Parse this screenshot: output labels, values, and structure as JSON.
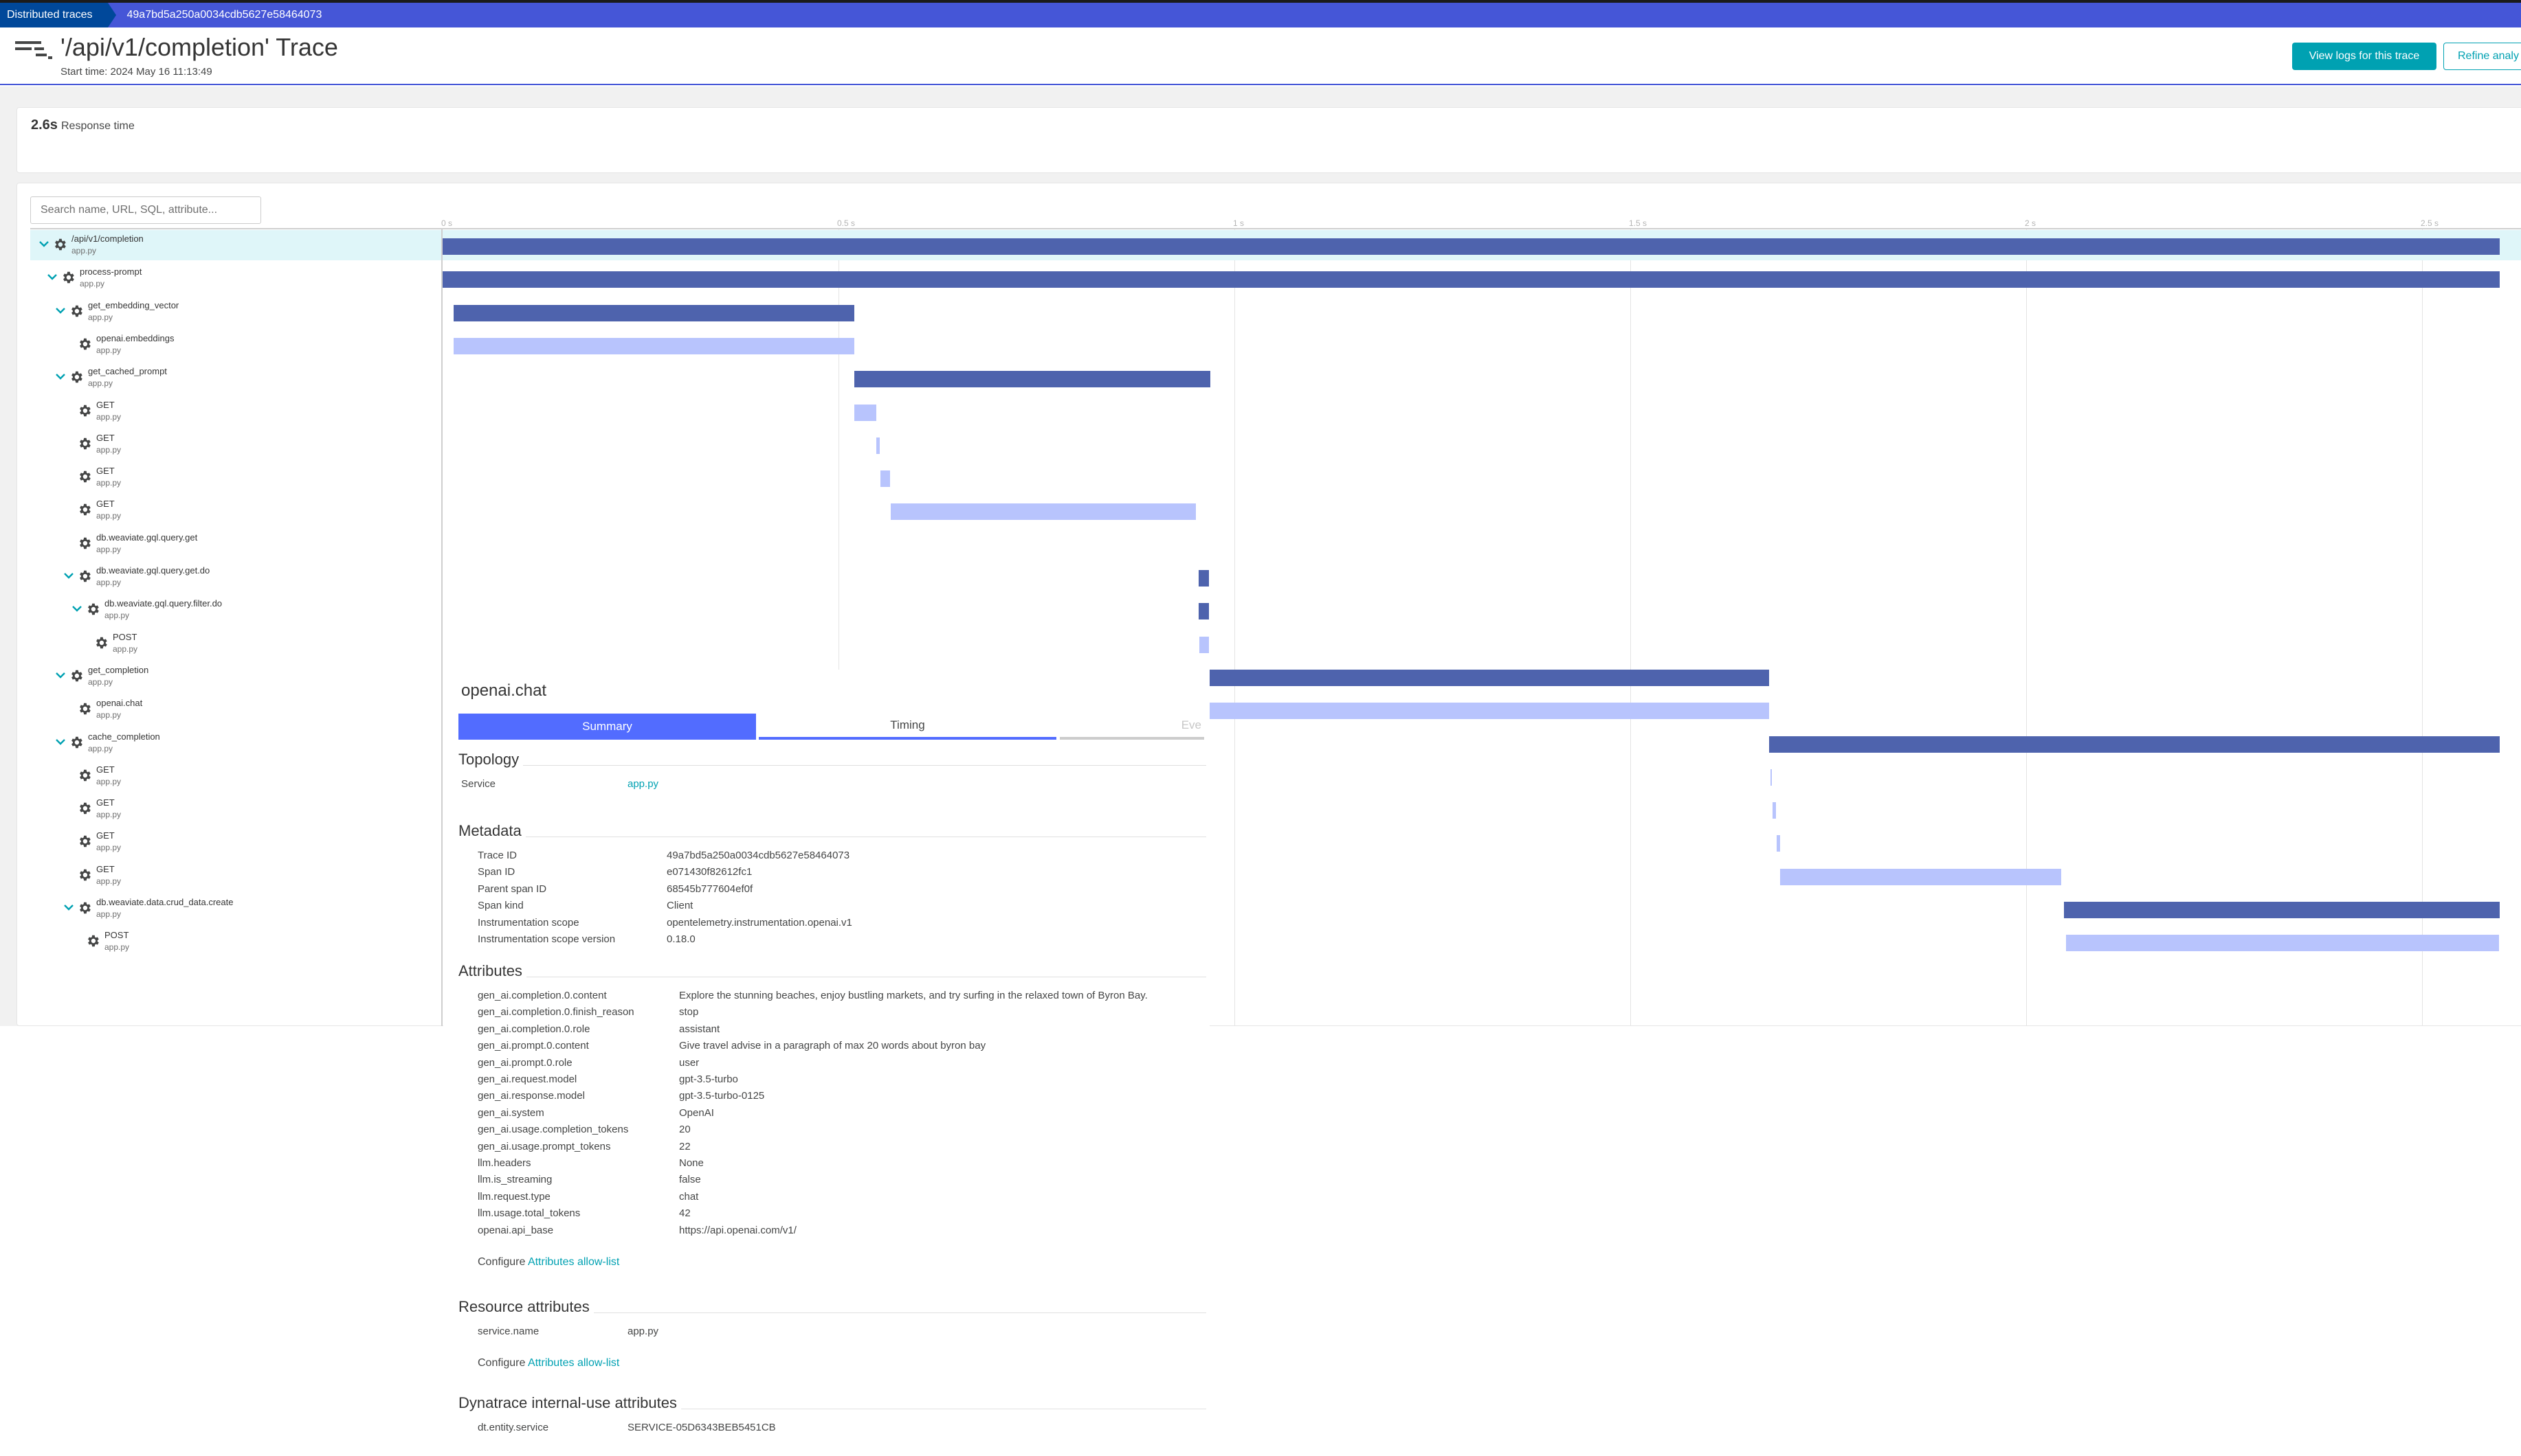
{
  "breadcrumb": {
    "items": [
      "Distributed traces",
      "49a7bd5a250a0034cdb5627e58464073"
    ]
  },
  "header": {
    "title": "'/api/v1/completion' Trace",
    "start_time": "Start time: 2024 May 16 11:13:49",
    "view_logs_button": "View logs for this trace",
    "refine_button": "Refine analy"
  },
  "summary": {
    "response_value": "2.6s",
    "response_label": "Response time"
  },
  "search": {
    "placeholder": "Search name, URL, SQL, attribute..."
  },
  "colors": {
    "accent": "#4556d7",
    "bar_parent": "#4e63ad",
    "bar_leaf": "#b8c4fd",
    "teal": "#00a1b2",
    "selected_row": "#dff6f9"
  },
  "chart_data": {
    "type": "gantt",
    "title": "",
    "xlabel": "",
    "unit": "s",
    "xlim": [
      0,
      2.65
    ],
    "ticks": [
      "0 s",
      "0.5 s",
      "1 s",
      "1.5 s",
      "2 s",
      "2.5 s"
    ],
    "tick_values": [
      0,
      0.5,
      1,
      1.5,
      2,
      2.5
    ],
    "spans": [
      {
        "name": "/api/v1/completion",
        "service": "app.py",
        "depth": 0,
        "expandable": true,
        "kind": "dark",
        "start": 0.0,
        "end": 2.598,
        "selected": true
      },
      {
        "name": "process-prompt",
        "service": "app.py",
        "depth": 1,
        "expandable": true,
        "kind": "dark",
        "start": 0.0,
        "end": 2.598
      },
      {
        "name": "get_embedding_vector",
        "service": "app.py",
        "depth": 2,
        "expandable": true,
        "kind": "dark",
        "start": 0.014,
        "end": 0.52
      },
      {
        "name": "openai.embeddings",
        "service": "app.py",
        "depth": 3,
        "expandable": false,
        "kind": "light",
        "start": 0.014,
        "end": 0.52
      },
      {
        "name": "get_cached_prompt",
        "service": "app.py",
        "depth": 2,
        "expandable": true,
        "kind": "dark",
        "start": 0.52,
        "end": 0.97
      },
      {
        "name": "GET",
        "service": "app.py",
        "depth": 3,
        "expandable": false,
        "kind": "light",
        "start": 0.52,
        "end": 0.548
      },
      {
        "name": "GET",
        "service": "app.py",
        "depth": 3,
        "expandable": false,
        "kind": "light",
        "start": 0.548,
        "end": 0.552
      },
      {
        "name": "GET",
        "service": "app.py",
        "depth": 3,
        "expandable": false,
        "kind": "light",
        "start": 0.553,
        "end": 0.565
      },
      {
        "name": "GET",
        "service": "app.py",
        "depth": 3,
        "expandable": false,
        "kind": "light",
        "start": 0.566,
        "end": 0.951
      },
      {
        "name": "db.weaviate.gql.query.get",
        "service": "app.py",
        "depth": 3,
        "expandable": false,
        "kind": "light",
        "start": null,
        "end": null
      },
      {
        "name": "db.weaviate.gql.query.get.do",
        "service": "app.py",
        "depth": 3,
        "expandable": true,
        "kind": "dark",
        "start": 0.955,
        "end": 0.968
      },
      {
        "name": "db.weaviate.gql.query.filter.do",
        "service": "app.py",
        "depth": 4,
        "expandable": true,
        "kind": "dark",
        "start": 0.955,
        "end": 0.968
      },
      {
        "name": "POST",
        "service": "app.py",
        "depth": 5,
        "expandable": false,
        "kind": "light",
        "start": 0.956,
        "end": 0.968
      },
      {
        "name": "get_completion",
        "service": "app.py",
        "depth": 2,
        "expandable": true,
        "kind": "dark",
        "start": 0.968,
        "end": 1.675
      },
      {
        "name": "openai.chat",
        "service": "app.py",
        "depth": 3,
        "expandable": false,
        "kind": "light",
        "start": 0.968,
        "end": 1.675
      },
      {
        "name": "cache_completion",
        "service": "app.py",
        "depth": 2,
        "expandable": true,
        "kind": "dark",
        "start": 1.675,
        "end": 2.598
      },
      {
        "name": "GET",
        "service": "app.py",
        "depth": 3,
        "expandable": false,
        "kind": "light",
        "start": 1.677,
        "end": 1.679
      },
      {
        "name": "GET",
        "service": "app.py",
        "depth": 3,
        "expandable": false,
        "kind": "light",
        "start": 1.68,
        "end": 1.684
      },
      {
        "name": "GET",
        "service": "app.py",
        "depth": 3,
        "expandable": false,
        "kind": "light",
        "start": 1.685,
        "end": 1.689
      },
      {
        "name": "GET",
        "service": "app.py",
        "depth": 3,
        "expandable": false,
        "kind": "light",
        "start": 1.689,
        "end": 2.044
      },
      {
        "name": "db.weaviate.data.crud_data.create",
        "service": "app.py",
        "depth": 3,
        "expandable": true,
        "kind": "dark",
        "start": 2.048,
        "end": 2.598
      },
      {
        "name": "POST",
        "service": "app.py",
        "depth": 4,
        "expandable": false,
        "kind": "light",
        "start": 2.05,
        "end": 2.597
      }
    ]
  },
  "detail": {
    "title": "openai.chat",
    "tabs": [
      "Summary",
      "Timing",
      "Eve"
    ],
    "active_tab": "Summary",
    "topology": {
      "heading": "Topology",
      "rows": [
        {
          "key": "Service",
          "value": "app.py",
          "link": true
        }
      ]
    },
    "metadata": {
      "heading": "Metadata",
      "rows": [
        {
          "key": "Trace ID",
          "value": "49a7bd5a250a0034cdb5627e58464073"
        },
        {
          "key": "Span ID",
          "value": "e071430f82612fc1"
        },
        {
          "key": "Parent span ID",
          "value": "68545b777604ef0f"
        },
        {
          "key": "Span kind",
          "value": "Client"
        },
        {
          "key": "Instrumentation scope",
          "value": "opentelemetry.instrumentation.openai.v1"
        },
        {
          "key": "Instrumentation scope version",
          "value": "0.18.0"
        }
      ]
    },
    "attributes": {
      "heading": "Attributes",
      "rows": [
        {
          "key": "gen_ai.completion.0.content",
          "value": "Explore the stunning beaches, enjoy bustling markets, and try surfing in the relaxed town of Byron Bay."
        },
        {
          "key": "gen_ai.completion.0.finish_reason",
          "value": "stop"
        },
        {
          "key": "gen_ai.completion.0.role",
          "value": "assistant"
        },
        {
          "key": "gen_ai.prompt.0.content",
          "value": "Give travel advise in a paragraph of max 20 words about byron bay"
        },
        {
          "key": "gen_ai.prompt.0.role",
          "value": "user"
        },
        {
          "key": "gen_ai.request.model",
          "value": "gpt-3.5-turbo"
        },
        {
          "key": "gen_ai.response.model",
          "value": "gpt-3.5-turbo-0125"
        },
        {
          "key": "gen_ai.system",
          "value": "OpenAI"
        },
        {
          "key": "gen_ai.usage.completion_tokens",
          "value": "20"
        },
        {
          "key": "gen_ai.usage.prompt_tokens",
          "value": "22"
        },
        {
          "key": "llm.headers",
          "value": "None"
        },
        {
          "key": "llm.is_streaming",
          "value": "false"
        },
        {
          "key": "llm.request.type",
          "value": "chat"
        },
        {
          "key": "llm.usage.total_tokens",
          "value": "42"
        },
        {
          "key": "openai.api_base",
          "value": "https://api.openai.com/v1/"
        }
      ],
      "configure_label": "Configure",
      "configure_link": "Attributes allow-list"
    },
    "resource_attributes": {
      "heading": "Resource attributes",
      "rows": [
        {
          "key": "service.name",
          "value": "app.py"
        }
      ],
      "configure_label": "Configure",
      "configure_link": "Attributes allow-list"
    },
    "internal_attributes": {
      "heading": "Dynatrace internal-use attributes",
      "rows": [
        {
          "key": "dt.entity.service",
          "value": "SERVICE-05D6343BEB5451CB"
        }
      ]
    }
  }
}
